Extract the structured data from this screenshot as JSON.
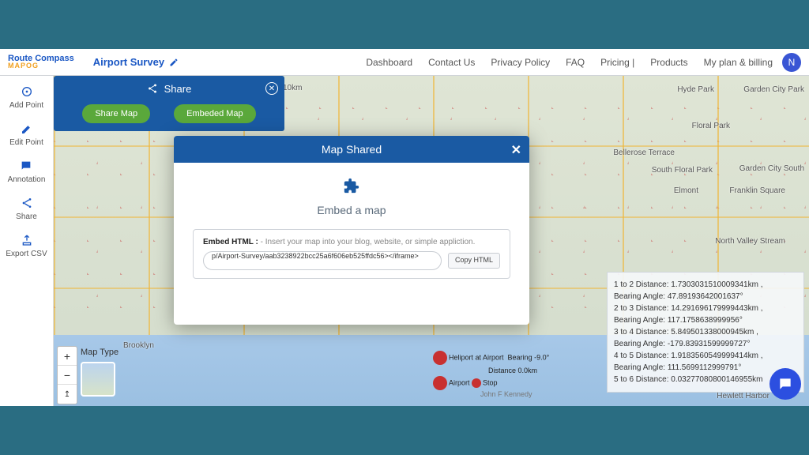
{
  "brand": {
    "line1": "Route Compass",
    "line2": "MAPOG"
  },
  "project": {
    "title": "Airport Survey"
  },
  "nav": {
    "dashboard": "Dashboard",
    "contact": "Contact Us",
    "privacy": "Privacy Policy",
    "faq": "FAQ",
    "pricing": "Pricing |",
    "products": "Products",
    "billing": "My plan & billing",
    "avatar": "N"
  },
  "sidebar": {
    "add": "Add Point",
    "edit": "Edit Point",
    "annotation": "Annotation",
    "share": "Share",
    "export": "Export CSV"
  },
  "sharePanel": {
    "title": "Share",
    "shareBtn": "Share Map",
    "embedBtn": "Embeded Map"
  },
  "modal": {
    "title": "Map Shared",
    "subtitle": "Embed a map",
    "labelBold": "Embed HTML :",
    "labelDesc": "- Insert your map into your blog, website, or simple appliction.",
    "code": "p/Airport-Survey/aab3238922bcc25a6f606eb525ffdc56></iframe>",
    "copy": "Copy HTML"
  },
  "info": {
    "l1": "1 to 2 Distance: 1.7303031510009341km ,",
    "l2": "Bearing Angle: 47.89193642001637°",
    "l3": "2 to 3 Distance: 14.291696179999443km ,",
    "l4": "Bearing Angle: 117.1758638999956°",
    "l5": "3 to 4 Distance: 5.849501338000945km ,",
    "l6": "Bearing Angle: -179.83931599999727°",
    "l7": "4 to 5 Distance: 1.9183560549999414km ,",
    "l8": "Bearing Angle: 111.5699112999791°",
    "l9": "5 to 6 Distance: 0.03277080800146955km"
  },
  "mapLabels": {
    "maptype": "Map Type",
    "brooklyn": "Brooklyn",
    "hyde": "Hyde Park",
    "garden": "Garden City Park",
    "floral": "Floral Park",
    "bellerose": "Bellerose Terrace",
    "southfloral": "South Floral Park",
    "gardensouth": "Garden City South",
    "elmont": "Elmont",
    "franklin": "Franklin Square",
    "northvalley": "North Valley Stream",
    "hewlett": "Hewlett Harbor",
    "heliport": "Heliport at Airport",
    "airport": "Airport",
    "bearing": "Bearing -9.0°",
    "distance": "Distance 0.0km",
    "stop": "Stop",
    "jfk": "John F Kennedy",
    "scale": "10km"
  }
}
